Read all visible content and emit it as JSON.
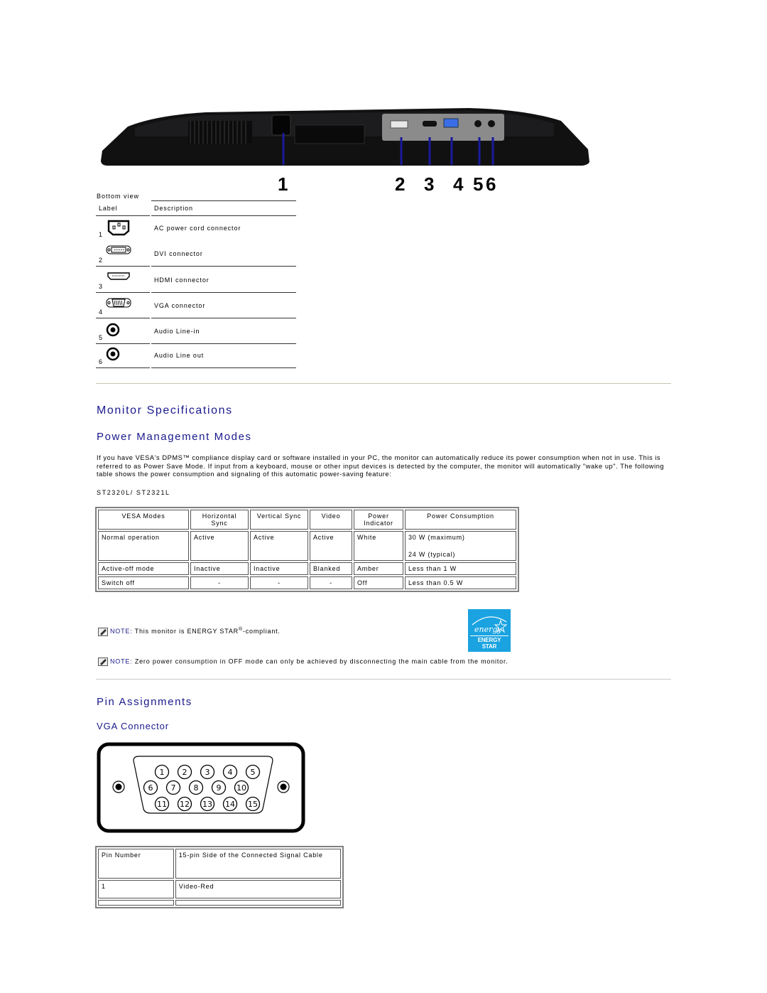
{
  "bottom_view": {
    "callouts": [
      "1",
      "2",
      "3",
      "4",
      "5",
      "6"
    ],
    "caption": "Bottom view",
    "header": {
      "label": "Label",
      "description": "Description"
    },
    "rows": [
      {
        "label": "1",
        "icon": "ac-power-icon",
        "description": "AC power cord connector"
      },
      {
        "label": "2",
        "icon": "dvi-connector-icon",
        "description": "DVI connector"
      },
      {
        "label": "3",
        "icon": "hdmi-connector-icon",
        "description": "HDMI connector"
      },
      {
        "label": "4",
        "icon": "vga-connector-icon",
        "description": "VGA connector"
      },
      {
        "label": "5",
        "icon": "audio-jack-icon",
        "description": "Audio Line-in"
      },
      {
        "label": "6",
        "icon": "audio-jack-icon",
        "description": "Audio Line out"
      }
    ]
  },
  "monitor_specs": {
    "title": "Monitor Specifications",
    "power_management": {
      "title": "Power Management Modes",
      "paragraph": "If you have VESA's DPMS™ compliance display card or software installed in your PC, the monitor can automatically reduce its power consumption when not in use. This is referred to as Power Save Mode. If input from a keyboard, mouse or other input devices is detected by the computer, the monitor will automatically \"wake up\". The following table shows the power consumption and signaling of this automatic power-saving feature:",
      "model": "ST2320L/ ST2321L",
      "table": {
        "headers": [
          "VESA Modes",
          "Horizontal Sync",
          "Vertical Sync",
          "Video",
          "Power Indicator",
          "Power Consumption"
        ],
        "rows": [
          [
            "Normal operation",
            "Active",
            "Active",
            "Active",
            "White",
            "30 W (maximum)",
            "24 W (typical)"
          ],
          [
            "Active-off mode",
            "Inactive",
            "Inactive",
            "Blanked",
            "Amber",
            "Less than 1 W"
          ],
          [
            "Switch off",
            "-",
            "-",
            "-",
            "Off",
            "Less than 0.5 W"
          ]
        ]
      },
      "notes": [
        {
          "label": "NOTE:",
          "text": " This monitor is ENERGY STAR",
          "sup": "®",
          "suffix": "-compliant."
        },
        {
          "label": "NOTE:",
          "text": " Zero power consumption in OFF mode can only be achieved by disconnecting the main cable from the monitor."
        }
      ],
      "energy_star_label": "ENERGY STAR",
      "energy_star_script": "energy"
    }
  },
  "pin_assignments": {
    "title": "Pin Assignments",
    "vga": {
      "title": "VGA Connector",
      "pins_row1": [
        "1",
        "2",
        "3",
        "4",
        "5"
      ],
      "pins_row2": [
        "6",
        "7",
        "8",
        "9",
        "10"
      ],
      "pins_row3": [
        "11",
        "12",
        "13",
        "14",
        "15"
      ]
    },
    "table": {
      "headers": [
        "Pin Number",
        "15-pin Side of the Connected Signal Cable"
      ],
      "rows": [
        [
          "1",
          "Video-Red"
        ]
      ]
    }
  }
}
